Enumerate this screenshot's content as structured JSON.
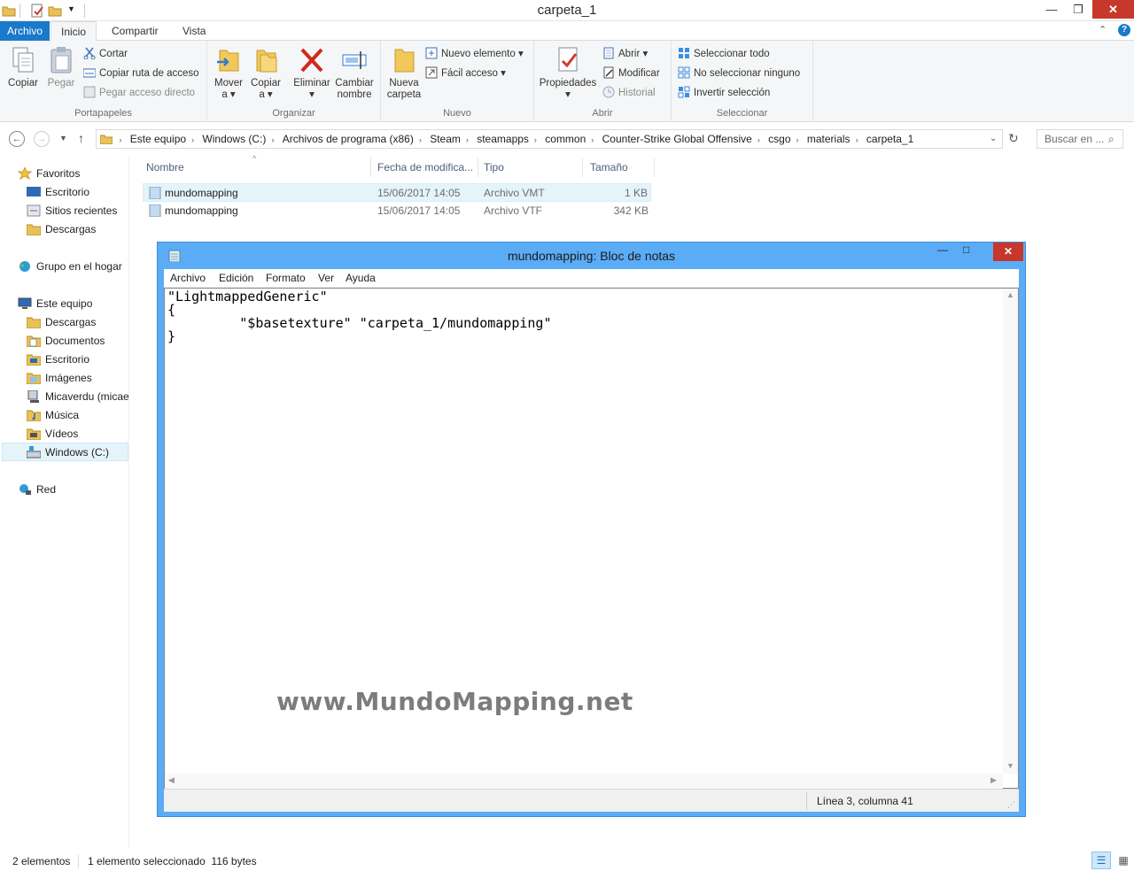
{
  "window": {
    "title": "carpeta_1"
  },
  "ribbon_tabs": [
    "Archivo",
    "Inicio",
    "Compartir",
    "Vista"
  ],
  "ribbon": {
    "portapapeles": {
      "label": "Portapapeles",
      "copiar": "Copiar",
      "pegar": "Pegar",
      "cortar": "Cortar",
      "copiar_ruta": "Copiar ruta de acceso",
      "pegar_acceso": "Pegar acceso directo"
    },
    "organizar": {
      "label": "Organizar",
      "mover1": "Mover",
      "mover2": "a",
      "copiar1": "Copiar",
      "copiar2": "a",
      "eliminar": "Eliminar",
      "cambiar1": "Cambiar",
      "cambiar2": "nombre"
    },
    "nuevo": {
      "label": "Nuevo",
      "nueva1": "Nueva",
      "nueva2": "carpeta",
      "nuevo_elemento": "Nuevo elemento",
      "facil_acceso": "Fácil acceso"
    },
    "abrir": {
      "label": "Abrir",
      "propiedades": "Propiedades",
      "abrir": "Abrir",
      "modificar": "Modificar",
      "historial": "Historial"
    },
    "seleccionar": {
      "label": "Seleccionar",
      "todo": "Seleccionar todo",
      "ninguno": "No seleccionar ninguno",
      "invertir": "Invertir selección"
    }
  },
  "address": {
    "crumbs": [
      "Este equipo",
      "Windows (C:)",
      "Archivos de programa (x86)",
      "Steam",
      "steamapps",
      "common",
      "Counter-Strike Global Offensive",
      "csgo",
      "materials",
      "carpeta_1"
    ],
    "search_placeholder": "Buscar en ..."
  },
  "nav": {
    "favoritos": "Favoritos",
    "fav_items": [
      "Escritorio",
      "Sitios recientes",
      "Descargas"
    ],
    "grupo": "Grupo en el hogar",
    "equipo": "Este equipo",
    "equipo_items": [
      "Descargas",
      "Documentos",
      "Escritorio",
      "Imágenes",
      "Micaverdu (micae",
      "Música",
      "Vídeos",
      "Windows (C:)"
    ],
    "red": "Red"
  },
  "columns": {
    "nombre": "Nombre",
    "fecha": "Fecha de modifica...",
    "tipo": "Tipo",
    "tamano": "Tamaño"
  },
  "files": [
    {
      "name": "mundomapping",
      "date": "15/06/2017 14:05",
      "type": "Archivo VMT",
      "size": "1 KB"
    },
    {
      "name": "mundomapping",
      "date": "15/06/2017 14:05",
      "type": "Archivo VTF",
      "size": "342 KB"
    }
  ],
  "notepad": {
    "title": "mundomapping: Bloc de notas",
    "menu": [
      "Archivo",
      "Edición",
      "Formato",
      "Ver",
      "Ayuda"
    ],
    "content": "\"LightmappedGeneric\"\n{\n\t\"$basetexture\" \"carpeta_1/mundomapping\"\n}",
    "status": "Línea 3, columna 41",
    "watermark": "www.MundoMapping.net"
  },
  "statusbar": {
    "count": "2 elementos",
    "selected": "1 elemento seleccionado  116 bytes"
  },
  "colors": {
    "accent": "#1979ca",
    "close": "#c7372b",
    "notepad_frame": "#5bacf6",
    "selected_row": "#e5f3fb"
  }
}
